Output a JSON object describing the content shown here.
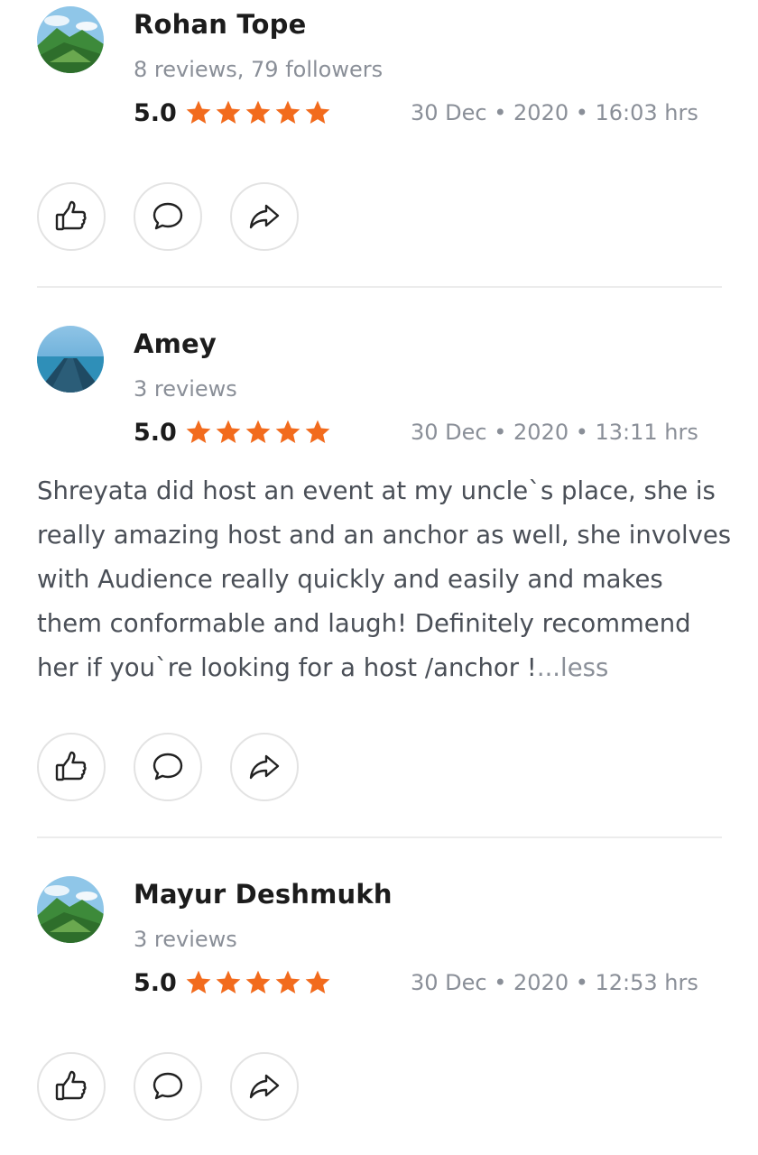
{
  "reviews": [
    {
      "name": "Rohan Tope",
      "meta": "8 reviews, 79 followers",
      "score": "5.0",
      "stars": 5,
      "date": "30 Dec • 2020 • 16:03 hrs",
      "avatar_icon": "mountain-landscape-icon",
      "text": "",
      "less": ""
    },
    {
      "name": "Amey",
      "meta": "3 reviews",
      "score": "5.0",
      "stars": 5,
      "date": "30 Dec • 2020 • 13:11 hrs",
      "avatar_icon": "sea-pier-icon",
      "text": "Shreyata did host an event at my uncle`s place, she is really amazing host and an anchor as well, she involves with Audience really quickly and easily and makes them conformable and laugh! Definitely recommend her if you`re looking for a host /anchor !",
      "less": "...less"
    },
    {
      "name": "Mayur Deshmukh",
      "meta": "3 reviews",
      "score": "5.0",
      "stars": 5,
      "date": "30 Dec • 2020 • 12:53 hrs",
      "avatar_icon": "mountain-landscape-icon",
      "text": "",
      "less": ""
    }
  ],
  "actions": [
    "like-icon",
    "comment-icon",
    "share-icon"
  ],
  "colors": {
    "star": "#f26b1d",
    "muted": "#8a8f98",
    "body_text": "#4a4f57",
    "divider": "#ececec"
  }
}
